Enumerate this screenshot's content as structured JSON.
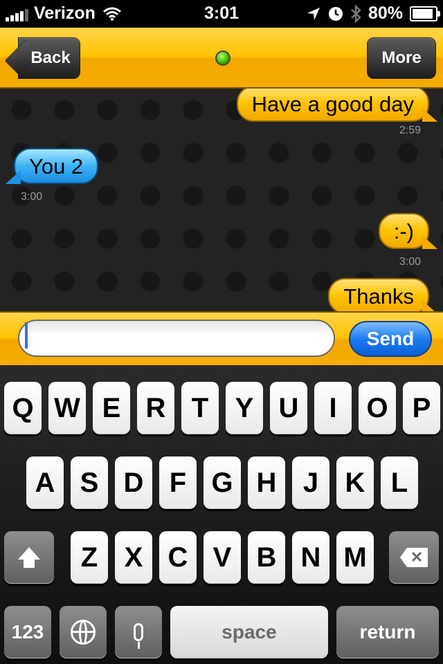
{
  "status_bar": {
    "carrier": "Verizon",
    "time": "3:01",
    "battery": "80%",
    "battery_level": 0.8,
    "icons": [
      "signal-icon",
      "wifi-icon",
      "location-icon",
      "clock-icon",
      "bluetooth-icon",
      "battery-icon"
    ]
  },
  "nav": {
    "back_label": "Back",
    "more_label": "More",
    "online_color": "#33aa00"
  },
  "messages": [
    {
      "text": "Have a good day",
      "time": "2:59",
      "from": "me"
    },
    {
      "text": "You 2",
      "time": "3:00",
      "from": "them"
    },
    {
      "text": ":-)",
      "time": "3:00",
      "from": "me"
    },
    {
      "text": "Thanks",
      "time": "",
      "from": "me"
    }
  ],
  "input": {
    "value": "",
    "placeholder": "",
    "send_label": "Send"
  },
  "keyboard": {
    "row1": [
      "Q",
      "W",
      "E",
      "R",
      "T",
      "Y",
      "U",
      "I",
      "O",
      "P"
    ],
    "row2": [
      "A",
      "S",
      "D",
      "F",
      "G",
      "H",
      "J",
      "K",
      "L"
    ],
    "row3": [
      "Z",
      "X",
      "C",
      "V",
      "B",
      "N",
      "M"
    ],
    "numbers_label": "123",
    "space_label": "space",
    "return_label": "return"
  },
  "colors": {
    "accent_orange": "#ffc300",
    "send_blue": "#1e7cf0",
    "bubble_me": "#ffc200",
    "bubble_them": "#3fb3f5"
  }
}
